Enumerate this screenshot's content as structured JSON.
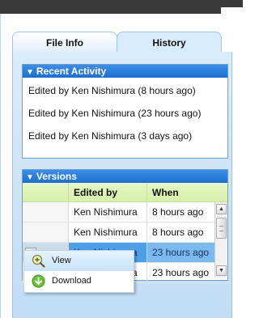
{
  "tabs": [
    {
      "label": "File Info",
      "active": false
    },
    {
      "label": "History",
      "active": true
    }
  ],
  "recent_activity": {
    "title": "Recent Activity",
    "items": [
      "Edited by Ken Nishimura (8 hours ago)",
      "Edited by Ken Nishimura (23 hours ago)",
      "Edited by Ken Nishimura (3 days ago)"
    ]
  },
  "versions": {
    "title": "Versions",
    "columns": [
      "Edited by",
      "When"
    ],
    "rows": [
      {
        "edited_by": "Ken Nishimura",
        "when": "8 hours ago"
      },
      {
        "edited_by": "Ken Nishimura",
        "when": "8 hours ago"
      },
      {
        "edited_by": "Ken Nishimura",
        "when": "23 hours ago",
        "selected": true
      },
      {
        "edited_by": "Ken Nishimura",
        "when": "23 hours ago"
      }
    ]
  },
  "context_menu": {
    "items": [
      {
        "label": "View",
        "icon": "magnify-plus-icon"
      },
      {
        "label": "Download",
        "icon": "download-arrow-icon"
      }
    ]
  },
  "colors": {
    "header_blue": "#1c6fd0",
    "selected_row": "#4d9ee8",
    "column_header_green": "#d5efa8"
  }
}
